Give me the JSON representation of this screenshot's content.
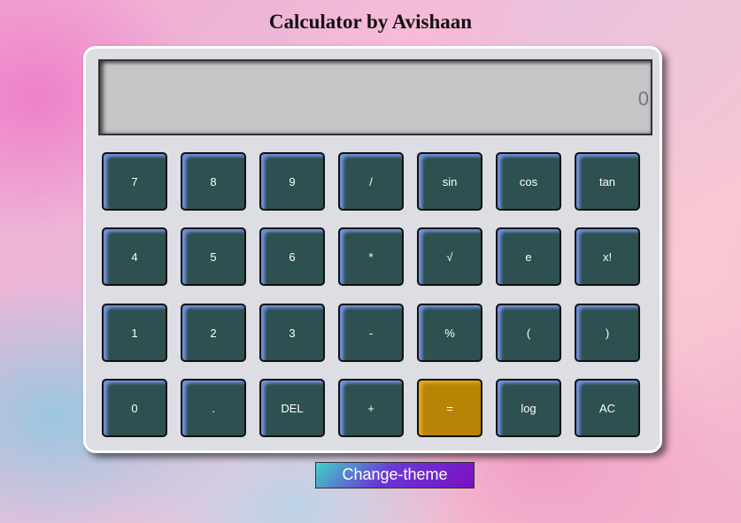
{
  "app": {
    "title": "Calculator by Avishaan"
  },
  "display": {
    "value": "0"
  },
  "keypad": {
    "rows": [
      [
        "7",
        "8",
        "9",
        "/",
        "sin",
        "cos",
        "tan"
      ],
      [
        "4",
        "5",
        "6",
        "*",
        "√",
        "e",
        "x!"
      ],
      [
        "1",
        "2",
        "3",
        "-",
        "%",
        "(",
        ")"
      ],
      [
        "0",
        ".",
        "DEL",
        "+",
        "=",
        "log",
        "AC"
      ]
    ]
  },
  "theme_button": {
    "label": "Change-theme"
  },
  "colors": {
    "key_face": "#2e5050",
    "key_highlight": "#6f90dc",
    "equals_key": "#b88405",
    "display_bg": "#c5c6c8",
    "panel_bg": "#dcdee4"
  }
}
